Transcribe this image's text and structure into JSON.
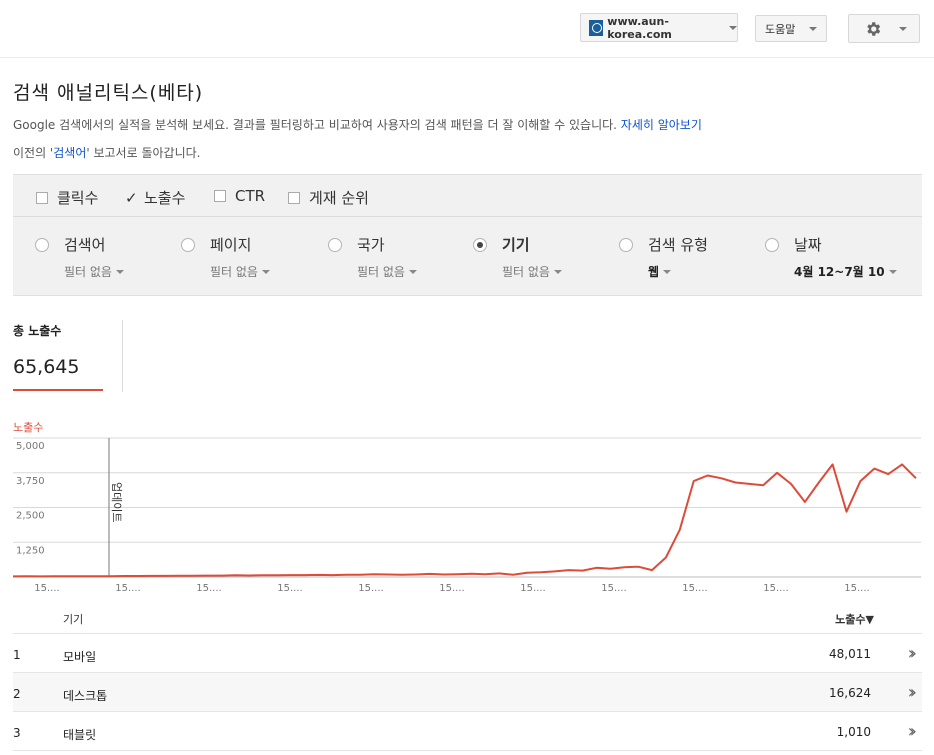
{
  "topbar": {
    "site": "www.aun-korea.com",
    "help": "도움말"
  },
  "page": {
    "title": "검색 애널리틱스(베타)",
    "description": "Google 검색에서의 실적을 분석해 보세요. 결과를 필터링하고 비교하여 사용자의 검색 패턴을 더 잘 이해할 수 있습니다.",
    "learn_more": "자세히 알아보기",
    "back_prefix": "이전의 '",
    "back_link": "검색어",
    "back_suffix": "' 보고서로 돌아갑니다."
  },
  "metrics": [
    {
      "label": "클릭수",
      "checked": false
    },
    {
      "label": "노출수",
      "checked": true
    },
    {
      "label": "CTR",
      "checked": false
    },
    {
      "label": "게재 순위",
      "checked": false
    }
  ],
  "dimensions": [
    {
      "label": "검색어",
      "sub": "필터 없음",
      "selected": false
    },
    {
      "label": "페이지",
      "sub": "필터 없음",
      "selected": false
    },
    {
      "label": "국가",
      "sub": "필터 없음",
      "selected": false
    },
    {
      "label": "기기",
      "sub": "필터 없음",
      "selected": true
    },
    {
      "label": "검색 유형",
      "sub": "웹",
      "selected": false
    },
    {
      "label": "날짜",
      "sub": "4월 12~7월 10",
      "selected": false
    }
  ],
  "totals": {
    "label": "총 노출수",
    "value": "65,645"
  },
  "chart_data": {
    "type": "line",
    "series_label": "노출수",
    "color": "#dd4b39",
    "annotation": "업데이트",
    "y_ticks": [
      "5,000",
      "3,750",
      "2,500",
      "1,250"
    ],
    "ylim": [
      0,
      5000
    ],
    "x_tick_label": "15....",
    "x_tick_count": 11,
    "values": [
      20,
      25,
      20,
      25,
      30,
      30,
      30,
      30,
      35,
      35,
      40,
      40,
      45,
      45,
      50,
      50,
      60,
      55,
      60,
      60,
      70,
      70,
      75,
      70,
      80,
      80,
      100,
      90,
      80,
      90,
      110,
      90,
      100,
      120,
      100,
      130,
      80,
      150,
      170,
      200,
      250,
      230,
      330,
      300,
      350,
      370,
      250,
      700,
      1700,
      3450,
      3650,
      3550,
      3400,
      3350,
      3300,
      3750,
      3350,
      2700,
      3400,
      4050,
      2350,
      3450,
      3900,
      3700,
      4050,
      3550
    ]
  },
  "table": {
    "headers": {
      "device": "기기",
      "impressions": "노출수▼"
    },
    "rows": [
      {
        "num": "1",
        "device": "모바일",
        "impressions": "48,011"
      },
      {
        "num": "2",
        "device": "데스크톱",
        "impressions": "16,624"
      },
      {
        "num": "3",
        "device": "태블릿",
        "impressions": "1,010"
      }
    ]
  }
}
